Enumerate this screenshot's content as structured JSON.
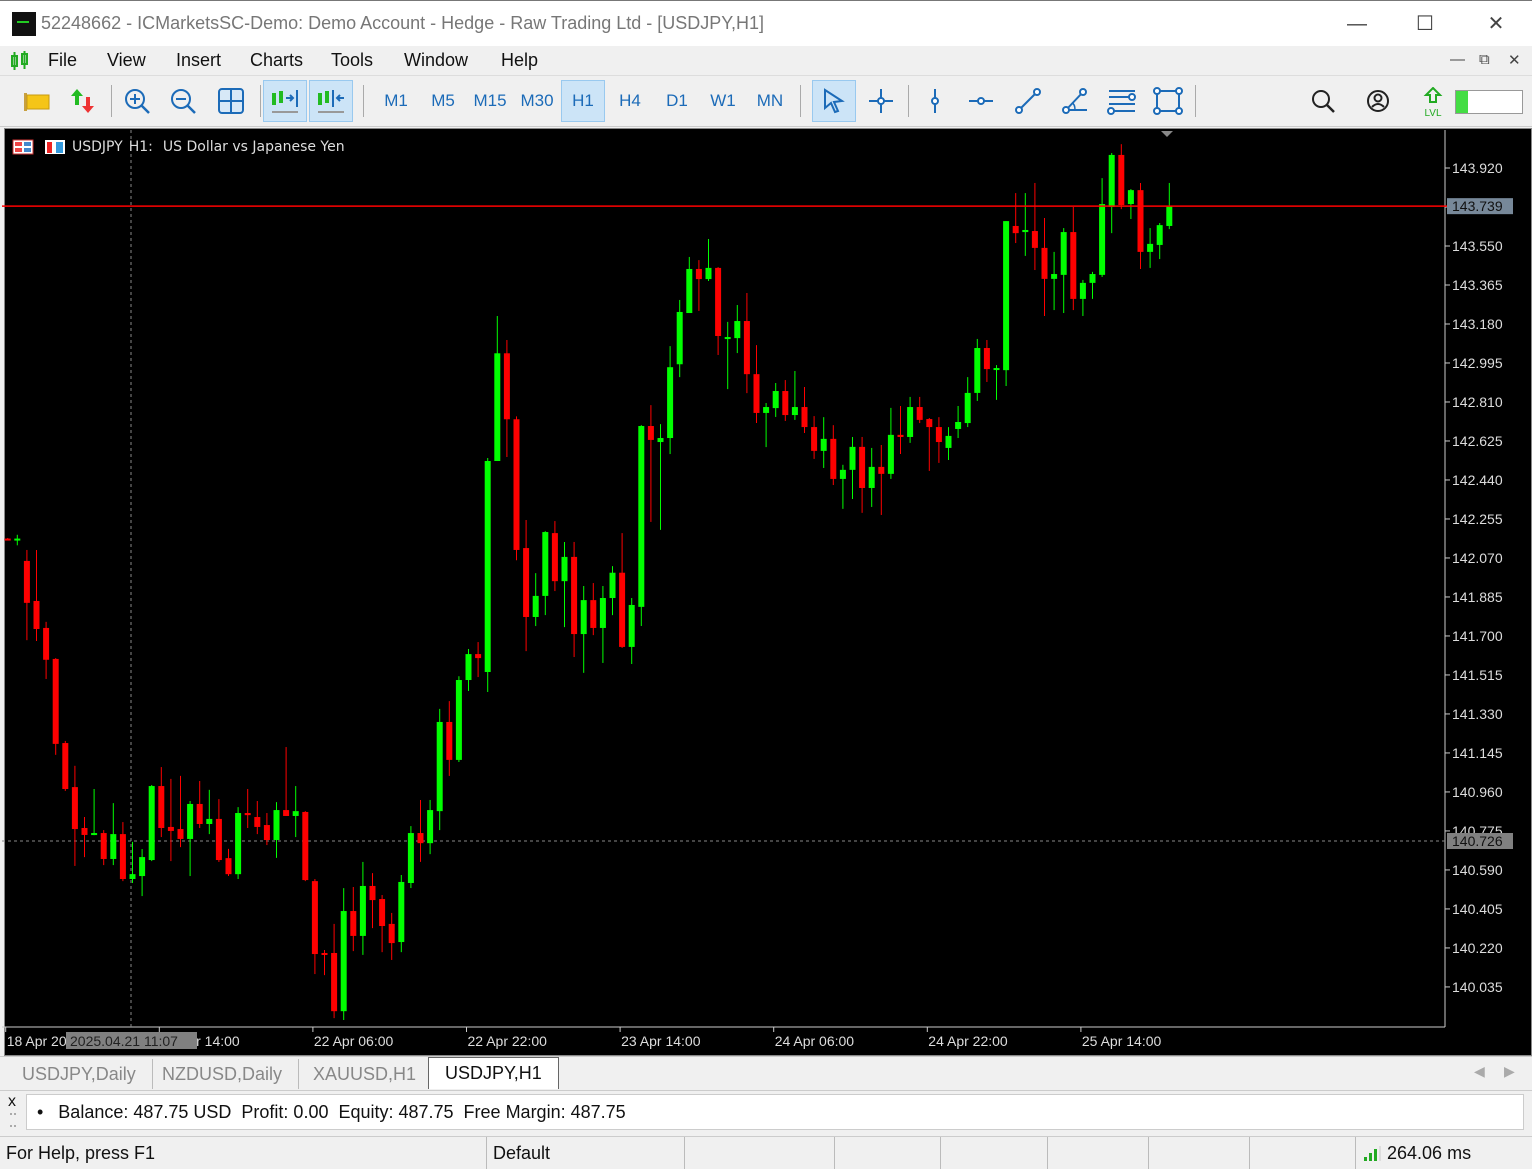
{
  "window": {
    "title": "52248662 - ICMarketsSC-Demo: Demo Account - Hedge - Raw Trading Ltd - [USDJPY,H1]"
  },
  "menu": [
    "File",
    "View",
    "Insert",
    "Charts",
    "Tools",
    "Window",
    "Help"
  ],
  "toolbar": {
    "timeframes": [
      "M1",
      "M5",
      "M15",
      "M30",
      "H1",
      "H4",
      "D1",
      "W1",
      "MN"
    ],
    "active_timeframe": "H1",
    "level_label": "LVL",
    "level_progress_percent": 18
  },
  "chart_header": {
    "symbol": "USDJPY",
    "timeframe": "H1:",
    "description": "US Dollar vs Japanese Yen"
  },
  "crosshair": {
    "time": "2025.04.21 11:07",
    "price": "140.726"
  },
  "current_price": "143.739",
  "colors": {
    "bull": "#00ff00",
    "bear": "#ff0000",
    "background": "#000000",
    "bid_line": "#ff0000",
    "accent": "#1c6bb8"
  },
  "chart_data": {
    "type": "candlestick",
    "symbol": "USDJPY",
    "timeframe": "H1",
    "ylim": [
      139.87,
      144.16
    ],
    "grid": false,
    "y_ticks": [
      "143.920",
      "143.735",
      "143.550",
      "143.365",
      "143.180",
      "142.995",
      "142.810",
      "142.625",
      "142.440",
      "142.255",
      "142.070",
      "141.885",
      "141.700",
      "141.515",
      "141.330",
      "141.145",
      "140.960",
      "140.775",
      "140.590",
      "140.405",
      "140.220",
      "140.035"
    ],
    "x_labels": [
      {
        "text": "18 Apr 2025",
        "bar": 0
      },
      {
        "text": "21 Apr 14:00",
        "bar": 16
      },
      {
        "text": "22 Apr 06:00",
        "bar": 32
      },
      {
        "text": "22 Apr 22:00",
        "bar": 48
      },
      {
        "text": "23 Apr 14:00",
        "bar": 64
      },
      {
        "text": "24 Apr 06:00",
        "bar": 80
      },
      {
        "text": "24 Apr 22:00",
        "bar": 96
      },
      {
        "text": "25 Apr 14:00",
        "bar": 112
      }
    ],
    "ohlc": [
      [
        142.162,
        142.165,
        142.155,
        142.158
      ],
      [
        142.155,
        142.18,
        142.13,
        142.162
      ],
      [
        142.056,
        142.108,
        141.68,
        141.857
      ],
      [
        141.866,
        142.108,
        141.676,
        141.733
      ],
      [
        141.738,
        141.767,
        141.496,
        141.587
      ],
      [
        141.591,
        141.595,
        141.136,
        141.188
      ],
      [
        141.192,
        141.202,
        140.965,
        140.974
      ],
      [
        140.983,
        141.084,
        140.609,
        140.784
      ],
      [
        140.789,
        140.841,
        140.651,
        140.756
      ],
      [
        140.76,
        140.974,
        140.755,
        140.765
      ],
      [
        140.765,
        140.779,
        140.613,
        140.642
      ],
      [
        140.642,
        140.907,
        140.613,
        140.76
      ],
      [
        140.76,
        140.817,
        140.537,
        140.547
      ],
      [
        140.547,
        140.723,
        140.528,
        140.57
      ],
      [
        140.561,
        140.689,
        140.466,
        140.651
      ],
      [
        140.637,
        140.993,
        140.632,
        140.988
      ],
      [
        140.988,
        141.078,
        140.746,
        140.789
      ],
      [
        140.794,
        141.022,
        140.632,
        140.775
      ],
      [
        140.784,
        141.036,
        140.698,
        140.737
      ],
      [
        140.737,
        140.917,
        140.561,
        140.903
      ],
      [
        140.903,
        141.012,
        140.789,
        140.808
      ],
      [
        140.808,
        140.97,
        140.76,
        140.832
      ],
      [
        140.832,
        140.926,
        140.628,
        140.637
      ],
      [
        140.646,
        140.69,
        140.561,
        140.57
      ],
      [
        140.57,
        140.888,
        140.547,
        140.86
      ],
      [
        140.86,
        140.974,
        140.789,
        140.85
      ],
      [
        140.841,
        140.917,
        140.76,
        140.794
      ],
      [
        140.803,
        140.86,
        140.708,
        140.732
      ],
      [
        140.732,
        140.912,
        140.647,
        140.874
      ],
      [
        140.874,
        141.173,
        140.846,
        140.846
      ],
      [
        140.846,
        140.988,
        140.746,
        140.869
      ],
      [
        140.865,
        140.869,
        140.537,
        140.542
      ],
      [
        140.537,
        140.547,
        140.096,
        140.191
      ],
      [
        140.196,
        140.21,
        140.091,
        140.191
      ],
      [
        140.196,
        140.334,
        139.887,
        139.92
      ],
      [
        139.92,
        140.504,
        139.878,
        140.395
      ],
      [
        140.395,
        140.509,
        140.205,
        140.277
      ],
      [
        140.277,
        140.628,
        140.187,
        140.514
      ],
      [
        140.514,
        140.575,
        140.314,
        140.447
      ],
      [
        140.452,
        140.471,
        140.2,
        140.324
      ],
      [
        140.334,
        140.386,
        140.163,
        140.243
      ],
      [
        140.248,
        140.566,
        140.2,
        140.533
      ],
      [
        140.528,
        140.798,
        140.504,
        140.765
      ],
      [
        140.765,
        140.922,
        140.628,
        140.717
      ],
      [
        140.717,
        140.922,
        140.665,
        140.874
      ],
      [
        140.869,
        141.354,
        140.779,
        141.292
      ],
      [
        141.292,
        141.391,
        141.036,
        141.112
      ],
      [
        141.112,
        141.509,
        141.102,
        141.491
      ],
      [
        141.491,
        141.638,
        141.439,
        141.614
      ],
      [
        141.614,
        141.671,
        141.505,
        141.595
      ],
      [
        141.529,
        142.544,
        141.434,
        142.53
      ],
      [
        142.53,
        143.218,
        142.53,
        143.041
      ],
      [
        143.041,
        143.104,
        142.549,
        142.728
      ],
      [
        142.728,
        142.742,
        142.059,
        142.108
      ],
      [
        142.117,
        142.25,
        141.628,
        141.79
      ],
      [
        141.79,
        141.998,
        141.747,
        141.89
      ],
      [
        141.89,
        142.197,
        141.799,
        142.193
      ],
      [
        142.188,
        142.245,
        141.913,
        141.96
      ],
      [
        141.96,
        142.146,
        141.742,
        142.075
      ],
      [
        142.075,
        142.146,
        141.6,
        141.709
      ],
      [
        141.709,
        141.937,
        141.525,
        141.87
      ],
      [
        141.87,
        141.951,
        141.704,
        141.738
      ],
      [
        141.738,
        141.937,
        141.572,
        141.88
      ],
      [
        141.88,
        142.031,
        141.799,
        142.0
      ],
      [
        142.0,
        142.188,
        141.643,
        141.648
      ],
      [
        141.648,
        141.88,
        141.567,
        141.847
      ],
      [
        141.838,
        142.7,
        141.747,
        142.696
      ],
      [
        142.696,
        142.795,
        142.241,
        142.63
      ],
      [
        142.62,
        142.705,
        142.203,
        142.639
      ],
      [
        142.639,
        143.075,
        142.563,
        142.975
      ],
      [
        142.989,
        143.294,
        142.928,
        143.237
      ],
      [
        143.232,
        143.498,
        143.232,
        143.441
      ],
      [
        143.441,
        143.483,
        143.242,
        143.393
      ],
      [
        143.393,
        143.583,
        143.384,
        143.446
      ],
      [
        143.446,
        143.45,
        143.033,
        143.123
      ],
      [
        143.113,
        143.19,
        142.871,
        143.118
      ],
      [
        143.113,
        143.27,
        143.042,
        143.194
      ],
      [
        143.194,
        143.327,
        142.852,
        142.942
      ],
      [
        142.942,
        143.08,
        142.71,
        142.758
      ],
      [
        142.758,
        142.805,
        142.596,
        142.786
      ],
      [
        142.781,
        142.9,
        142.739,
        142.862
      ],
      [
        142.862,
        142.914,
        142.72,
        142.748
      ],
      [
        142.748,
        142.957,
        142.725,
        142.786
      ],
      [
        142.786,
        142.881,
        142.663,
        142.691
      ],
      [
        142.691,
        142.743,
        142.54,
        142.578
      ],
      [
        142.578,
        142.738,
        142.497,
        142.635
      ],
      [
        142.635,
        142.7,
        142.416,
        142.445
      ],
      [
        142.445,
        142.512,
        142.303,
        142.488
      ],
      [
        142.488,
        142.644,
        142.35,
        142.597
      ],
      [
        142.597,
        142.644,
        142.284,
        142.402
      ],
      [
        142.402,
        142.592,
        142.312,
        142.502
      ],
      [
        142.502,
        142.606,
        142.274,
        142.469
      ],
      [
        142.469,
        142.782,
        142.445,
        142.654
      ],
      [
        142.654,
        142.791,
        142.563,
        142.644
      ],
      [
        142.644,
        142.834,
        142.616,
        142.786
      ],
      [
        142.786,
        142.834,
        142.71,
        142.725
      ],
      [
        142.729,
        142.734,
        142.483,
        142.691
      ],
      [
        142.691,
        142.738,
        142.521,
        142.62
      ],
      [
        142.592,
        142.691,
        142.535,
        142.649
      ],
      [
        142.682,
        142.791,
        142.639,
        142.715
      ],
      [
        142.71,
        142.928,
        142.691,
        142.853
      ],
      [
        142.853,
        143.109,
        142.815,
        143.066
      ],
      [
        143.066,
        143.104,
        142.905,
        142.966
      ],
      [
        142.966,
        142.985,
        142.82,
        142.971
      ],
      [
        142.961,
        143.668,
        142.886,
        143.668
      ],
      [
        143.645,
        143.801,
        143.564,
        143.611
      ],
      [
        143.616,
        143.801,
        143.503,
        143.626
      ],
      [
        143.621,
        143.849,
        143.436,
        143.541
      ],
      [
        143.541,
        143.683,
        143.218,
        143.394
      ],
      [
        143.394,
        143.522,
        143.246,
        143.417
      ],
      [
        143.413,
        143.635,
        143.232,
        143.616
      ],
      [
        143.616,
        143.735,
        143.246,
        143.299
      ],
      [
        143.299,
        143.389,
        143.218,
        143.375
      ],
      [
        143.375,
        143.427,
        143.299,
        143.417
      ],
      [
        143.413,
        143.872,
        143.403,
        143.749
      ],
      [
        143.735,
        143.991,
        143.611,
        143.982
      ],
      [
        143.982,
        144.033,
        143.725,
        143.744
      ],
      [
        143.749,
        143.82,
        143.678,
        143.815
      ],
      [
        143.815,
        143.849,
        143.441,
        143.522
      ],
      [
        143.522,
        143.635,
        143.446,
        143.56
      ],
      [
        143.555,
        143.659,
        143.488,
        143.649
      ],
      [
        143.645,
        143.849,
        143.63,
        143.739
      ]
    ]
  },
  "tabs": [
    {
      "label": "USDJPY,Daily",
      "active": false
    },
    {
      "label": "NZDUSD,Daily",
      "active": false
    },
    {
      "label": "XAUUSD,H1",
      "active": false
    },
    {
      "label": "USDJPY,H1",
      "active": true
    }
  ],
  "toolbox": {
    "close_label": "x",
    "account_line": "•   Balance: 487.75 USD  Profit: 0.00  Equity: 487.75  Free Margin: 487.75"
  },
  "statusbar": {
    "help": "For Help, press F1",
    "profile": "Default",
    "ping": "264.06 ms"
  }
}
